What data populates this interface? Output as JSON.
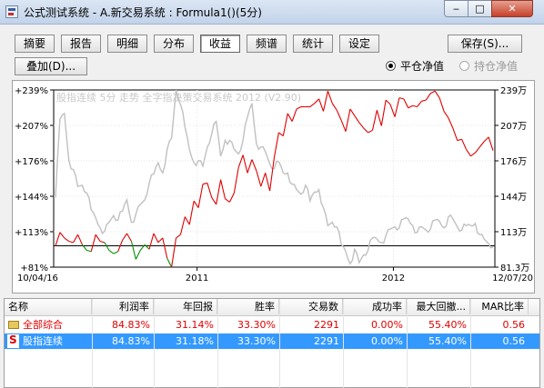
{
  "window": {
    "title": "公式测试系统 - A.新交易系统 : Formula1()(5分)",
    "buttons": {
      "minimize": "‒",
      "maximize": "□",
      "close": "✕"
    }
  },
  "toolbar": {
    "tabs": [
      "摘要",
      "报告",
      "明细",
      "分布",
      "收益",
      "频谱",
      "统计",
      "设定"
    ],
    "active_tab": "收益",
    "save_label": "保存(S)...",
    "overlay_label": "叠加(D)..."
  },
  "radios": {
    "flat_label": "平仓净值",
    "flat_selected": true,
    "hold_label": "持仓净值",
    "hold_enabled": false
  },
  "chart_data": {
    "type": "line",
    "title": "",
    "watermark": "股指连续 5分 走势    全字指决策交易系统 2012 (V2.90)",
    "y_left": {
      "ticks": [
        "+239%",
        "+207%",
        "+176%",
        "+144%",
        "+113%",
        "+81%"
      ],
      "range": [
        81,
        239
      ]
    },
    "y_right": {
      "ticks": [
        "239万",
        "207万",
        "176万",
        "144万",
        "113万",
        "81.3万"
      ],
      "range": [
        81.3,
        239
      ]
    },
    "x_labels": {
      "start": "10/04/16",
      "mid1": "2011",
      "mid2": "2012",
      "end": "12/07/20"
    },
    "baseline_percent": 100,
    "series": [
      {
        "name": "收益",
        "color": "#e00000",
        "below_baseline_color": "#009000",
        "values": [
          100,
          112,
          107,
          104,
          103,
          110,
          101,
          96,
          95,
          110,
          104,
          103,
          96,
          93,
          95,
          105,
          111,
          104,
          88,
          96,
          101,
          97,
          111,
          103,
          107,
          89,
          81,
          107,
          110,
          126,
          119,
          140,
          134,
          155,
          156,
          143,
          137,
          159,
          142,
          139,
          147,
          170,
          181,
          165,
          177,
          167,
          153,
          165,
          149,
          179,
          201,
          198,
          218,
          211,
          222,
          224,
          224,
          224,
          227,
          231,
          220,
          238,
          227,
          221,
          212,
          202,
          222,
          216,
          210,
          205,
          201,
          203,
          221,
          207,
          230,
          226,
          215,
          232,
          231,
          223,
          225,
          224,
          229,
          230,
          236,
          238,
          232,
          220,
          214,
          205,
          194,
          195,
          186,
          180,
          183,
          188,
          193,
          197,
          185
        ]
      },
      {
        "name": "股指连续",
        "color": "#c0c0c0",
        "values": [
          143,
          213,
          218,
          176,
          168,
          153,
          154,
          147,
          132,
          125,
          116,
          113,
          121,
          127,
          123,
          131,
          141,
          121,
          128,
          137,
          141,
          156,
          164,
          174,
          165,
          186,
          196,
          239,
          226,
          206,
          186,
          174,
          176,
          171,
          188,
          200,
          211,
          180,
          194,
          194,
          186,
          182,
          194,
          215,
          227,
          191,
          188,
          184,
          173,
          169,
          175,
          165,
          165,
          155,
          150,
          146,
          154,
          140,
          148,
          150,
          134,
          118,
          121,
          117,
          101,
          95,
          84,
          97,
          85,
          92,
          96,
          107,
          106,
          103,
          109,
          115,
          117,
          116,
          124,
          124,
          118,
          112,
          117,
          114,
          115,
          123,
          122,
          116,
          126,
          124,
          117,
          114,
          118,
          118,
          120,
          110,
          106,
          102,
          99
        ]
      }
    ]
  },
  "table": {
    "headers": [
      "名称",
      "利润率",
      "年回报",
      "胜率",
      "交易数",
      "成功率",
      "最大回撤...",
      "MAR比率"
    ],
    "rows": [
      {
        "icon": "folder-icon",
        "name": "全部综合",
        "profit": "84.83%",
        "annual": "31.14%",
        "win": "33.30%",
        "trades": "2291",
        "success": "0.00%",
        "drawdown": "55.40%",
        "mar": "0.56"
      },
      {
        "icon": "s-icon",
        "icon_letter": "S",
        "name": "股指连续",
        "profit": "84.83%",
        "annual": "31.18%",
        "win": "33.30%",
        "trades": "2291",
        "success": "0.00%",
        "drawdown": "55.40%",
        "mar": "0.56"
      }
    ]
  }
}
